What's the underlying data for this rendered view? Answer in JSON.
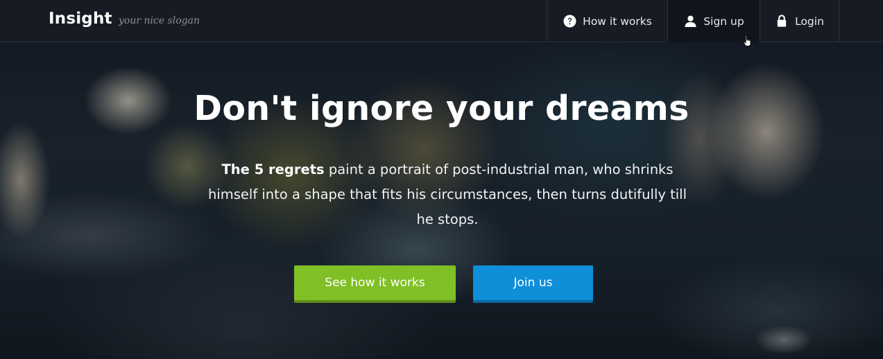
{
  "navbar": {
    "brand": "Insight",
    "slogan": "your nice slogan",
    "items": [
      {
        "label": "How it works",
        "icon": "question-circle-icon"
      },
      {
        "label": "Sign up",
        "icon": "user-icon"
      },
      {
        "label": "Login",
        "icon": "lock-icon"
      }
    ]
  },
  "hero": {
    "headline": "Don't ignore your dreams",
    "lead_bold": "The 5 regrets",
    "lead_rest": " paint a portrait of post-industrial man, who shrinks himself into a shape that fits his circumstances, then turns dutifully till he stops.",
    "buttons": {
      "primary_label": "See how it works",
      "secondary_label": "Join us"
    }
  },
  "colors": {
    "navbar_bg": "#181c24",
    "green_button": "#80c026",
    "blue_button": "#0f8fd8",
    "text": "#ffffff"
  }
}
